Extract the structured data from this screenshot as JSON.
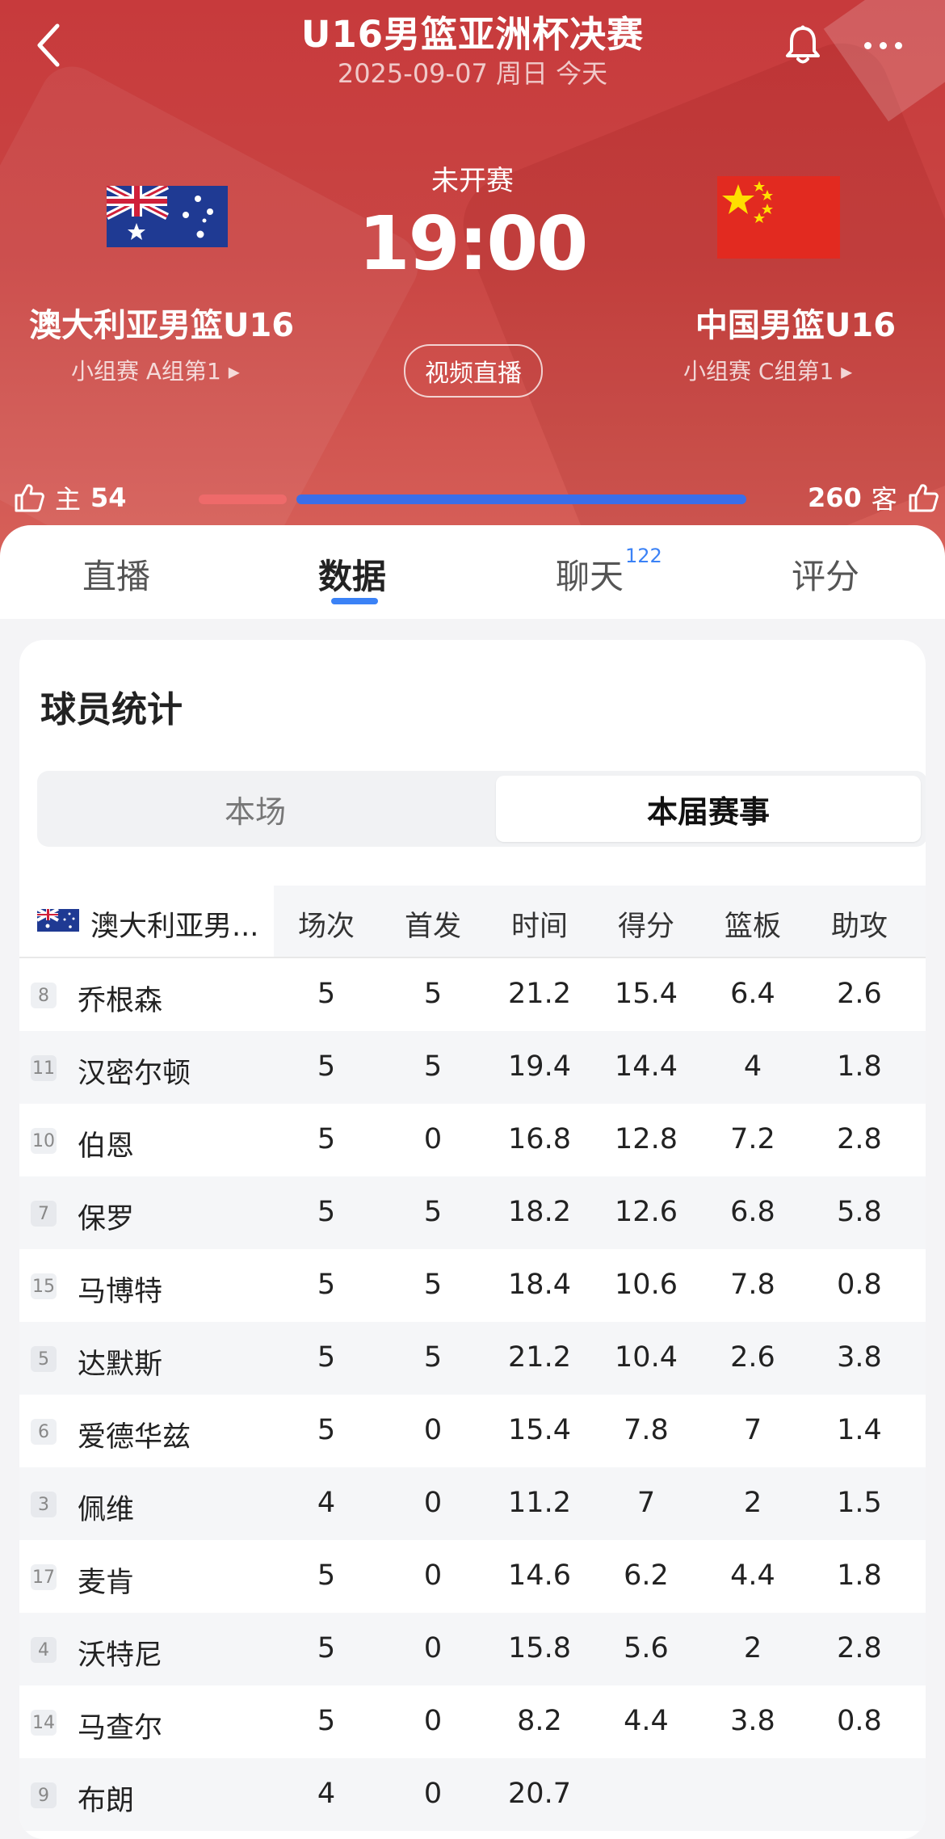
{
  "header": {
    "title": "U16男篮亚洲杯决赛",
    "subtitle": "2025-09-07 周日 今天",
    "status": "未开赛",
    "time": "19:00",
    "live_button": "视频直播"
  },
  "home_team": {
    "name": "澳大利亚男篮U16",
    "group": "小组赛 A组第1 ▸",
    "vote_label": "主",
    "votes": "54",
    "flag": "australia-flag"
  },
  "away_team": {
    "name": "中国男篮U16",
    "group": "小组赛 C组第1 ▸",
    "vote_label": "客",
    "votes": "260",
    "flag": "china-flag"
  },
  "support": {
    "home_fraction": 0.17,
    "away_fraction": 0.83,
    "home_color": "#ee6a6a",
    "away_color": "#3b6ee8"
  },
  "tabs": [
    {
      "label": "直播"
    },
    {
      "label": "数据",
      "active": true
    },
    {
      "label": "聊天",
      "badge": "122"
    },
    {
      "label": "评分"
    }
  ],
  "stats": {
    "title": "球员统计",
    "segments": [
      "本场",
      "本届赛事"
    ],
    "active_segment": 1,
    "team_label": "澳大利亚男...",
    "columns": [
      "场次",
      "首发",
      "时间",
      "得分",
      "篮板",
      "助攻"
    ],
    "players": [
      {
        "num": "8",
        "name": "乔根森",
        "stats": [
          "5",
          "5",
          "21.2",
          "15.4",
          "6.4",
          "2.6"
        ]
      },
      {
        "num": "11",
        "name": "汉密尔顿",
        "stats": [
          "5",
          "5",
          "19.4",
          "14.4",
          "4",
          "1.8"
        ]
      },
      {
        "num": "10",
        "name": "伯恩",
        "stats": [
          "5",
          "0",
          "16.8",
          "12.8",
          "7.2",
          "2.8"
        ]
      },
      {
        "num": "7",
        "name": "保罗",
        "stats": [
          "5",
          "5",
          "18.2",
          "12.6",
          "6.8",
          "5.8"
        ]
      },
      {
        "num": "15",
        "name": "马博特",
        "stats": [
          "5",
          "5",
          "18.4",
          "10.6",
          "7.8",
          "0.8"
        ]
      },
      {
        "num": "5",
        "name": "达默斯",
        "stats": [
          "5",
          "5",
          "21.2",
          "10.4",
          "2.6",
          "3.8"
        ]
      },
      {
        "num": "6",
        "name": "爱德华兹",
        "stats": [
          "5",
          "0",
          "15.4",
          "7.8",
          "7",
          "1.4"
        ]
      },
      {
        "num": "3",
        "name": "佩维",
        "stats": [
          "4",
          "0",
          "11.2",
          "7",
          "2",
          "1.5"
        ]
      },
      {
        "num": "17",
        "name": "麦肯",
        "stats": [
          "5",
          "0",
          "14.6",
          "6.2",
          "4.4",
          "1.8"
        ]
      },
      {
        "num": "4",
        "name": "沃特尼",
        "stats": [
          "5",
          "0",
          "15.8",
          "5.6",
          "2",
          "2.8"
        ]
      },
      {
        "num": "14",
        "name": "马查尔",
        "stats": [
          "5",
          "0",
          "8.2",
          "4.4",
          "3.8",
          "0.8"
        ]
      },
      {
        "num": "9",
        "name": "布朗",
        "stats": [
          "4",
          "0",
          "20.7",
          "",
          "",
          ""
        ]
      }
    ]
  }
}
